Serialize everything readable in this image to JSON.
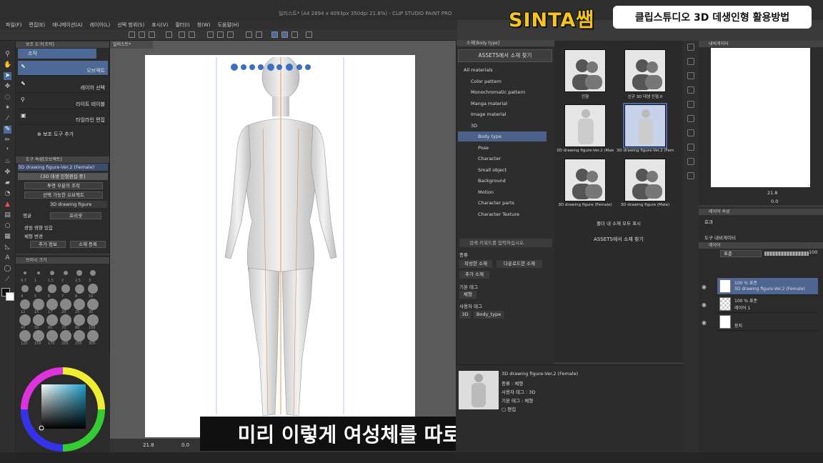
{
  "window": {
    "title": "일러스트* (A4 2894 x 4093px 350dpi 21.8%) - CLIP STUDIO PAINT PRO"
  },
  "banner": {
    "logo": "SINTA쌤",
    "subtitle": "클립스튜디오 3D 데생인형 활용방법"
  },
  "menu": [
    "파일(F)",
    "편집(E)",
    "애니메이션(A)",
    "레이어(L)",
    "선택 범위(S)",
    "표시(V)",
    "필터(I)",
    "창(W)",
    "도움말(H)"
  ],
  "subtool": {
    "panel_title": "보조 도구[조작]",
    "group_label": "조작",
    "items": [
      {
        "label": "오브젝트",
        "icon": "cursor-icon"
      },
      {
        "label": "레이어 선택",
        "icon": "select-icon"
      },
      {
        "label": "라이트 테이블",
        "icon": "lighttable-icon"
      },
      {
        "label": "타임라인 편집",
        "icon": "timeline-icon"
      }
    ],
    "add_label": "보조 도구 추가"
  },
  "tool_property": {
    "panel_title": "도구 속성[오브젝트]",
    "object_name": "3D drawing figure-Ver.2 (Female)",
    "mode_label": "[3D 데생 인형편집 중]",
    "transparent_label": "투명 부분의 조작",
    "selectable_label": "선택 가능한 오브젝트",
    "object_row": "3D drawing figure",
    "camera_label": "앵글",
    "preset_label": "프리셋",
    "light_label": "광원 영향 있음",
    "body_change_label": "체형 변경",
    "add_label": "추가 정보",
    "parts_label": "소재 등록"
  },
  "brush_size": {
    "panel_title": "브러시 크기",
    "sizes": [
      "0.7",
      "1",
      "1.5",
      "2",
      "2.5",
      "3",
      "4",
      "5",
      "6",
      "7",
      "8",
      "10",
      "12",
      "15",
      "17",
      "20",
      "25",
      "30",
      "40",
      "50",
      "60",
      "70",
      "80",
      "100",
      "120",
      "150",
      "170",
      "200",
      "250",
      "300"
    ]
  },
  "canvas": {
    "tab": "일러스트*",
    "zoom": "21.8",
    "rotation": "0.0"
  },
  "caption": "미리 이렇게 여성체를 따로 불러온 다음에",
  "material": {
    "panel_title": "소재[Body type]",
    "find_button": "ASSETS에서 소재 찾기",
    "tree": [
      {
        "label": "All materials",
        "depth": 0
      },
      {
        "label": "Color pattern",
        "depth": 1
      },
      {
        "label": "Monochromatic pattern",
        "depth": 1
      },
      {
        "label": "Manga material",
        "depth": 1
      },
      {
        "label": "Image material",
        "depth": 1
      },
      {
        "label": "3D",
        "depth": 1
      },
      {
        "label": "Body type",
        "depth": 2
      },
      {
        "label": "Pose",
        "depth": 2
      },
      {
        "label": "Character",
        "depth": 2
      },
      {
        "label": "Small object",
        "depth": 2
      },
      {
        "label": "Background",
        "depth": 2
      },
      {
        "label": "Motion",
        "depth": 2
      },
      {
        "label": "Character parts",
        "depth": 2
      },
      {
        "label": "Character Texture",
        "depth": 2
      }
    ],
    "search_placeholder": "검색 키워드를 입력하십시오.",
    "kind_label": "종류",
    "kind_tags": [
      "작성한 소재",
      "다운로드한 소재",
      "추가 소재"
    ],
    "base_tag_label": "기본 태그",
    "base_tags": [
      "체형"
    ],
    "user_tag_label": "사용자 태그",
    "user_tags": [
      "3D",
      "Body_type"
    ],
    "thumbnails": [
      {
        "label": "인형"
      },
      {
        "label": "신규 3D 데생 인형.0"
      },
      {
        "label": "3D drawing figure-Ver.2 (Male)"
      },
      {
        "label": "3D drawing figure-Ver.2 (Fem"
      },
      {
        "label": "3D drawing figure (Female)"
      },
      {
        "label": "3D drawing figure (Male)"
      }
    ],
    "show_all": "폴더 내 소재 모두 표시",
    "find_button2": "ASSETS에서 소재 찾기",
    "info": {
      "name": "3D drawing figure-Ver.2 (Female)",
      "kind": "종류 : 체형",
      "user_tag": "사용자 태그 : 3D",
      "base_tag": "기본 태그 : 체형",
      "edit": "편집"
    }
  },
  "navigator": {
    "title": "내비게이터",
    "zoom": "21.8",
    "angle": "0.0"
  },
  "layer_property": {
    "title": "레이어 속성",
    "effect_label": "효과",
    "tool_label": "도구 내비게이터"
  },
  "layers": {
    "title": "레이어",
    "blend": "표준",
    "opacity": "100",
    "items": [
      {
        "line1": "100 % 표준",
        "line2": "3D drawing figure-Ver.2 (Female)",
        "selected": true
      },
      {
        "line1": "100 % 표준",
        "line2": "레이어 1",
        "selected": false
      },
      {
        "line1": "",
        "line2": "용지",
        "selected": false
      }
    ]
  },
  "colors": {
    "accent": "#4c6a9a",
    "banner_yellow": "#f7c520",
    "panel": "#2b2b2b"
  }
}
